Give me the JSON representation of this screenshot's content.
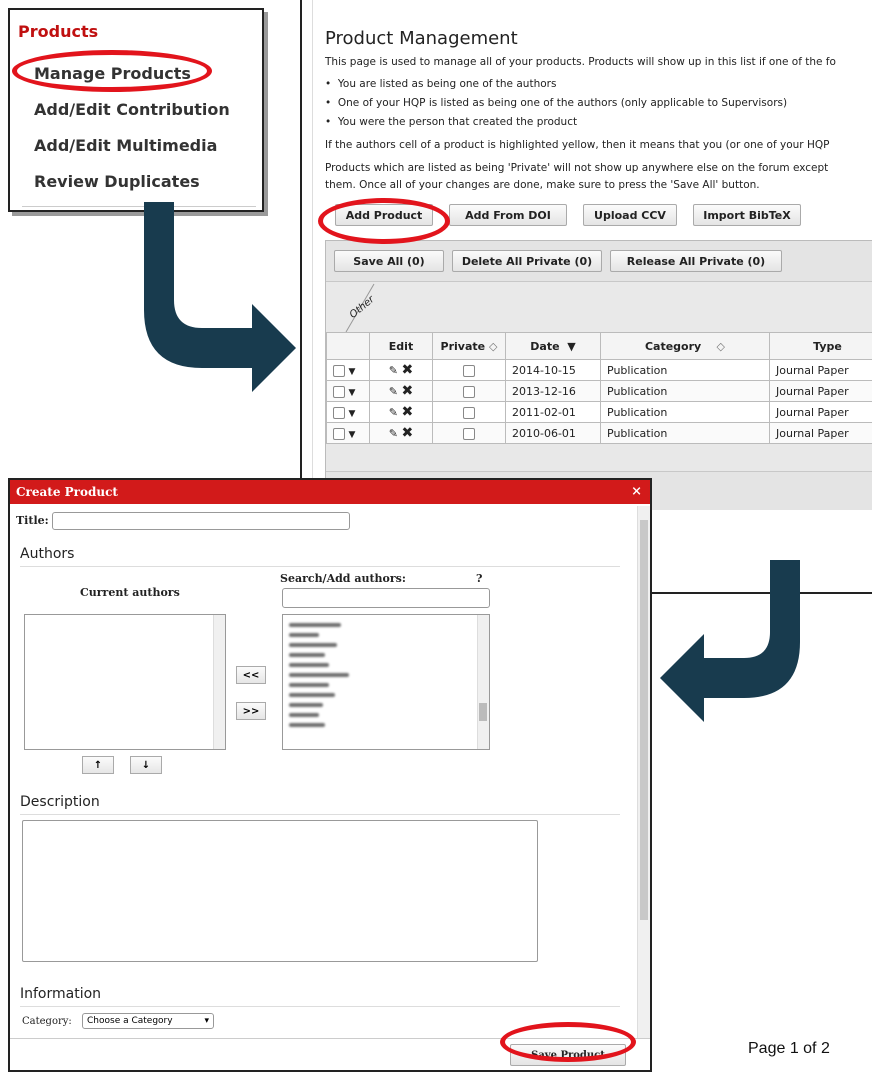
{
  "sidebar": {
    "heading": "Products",
    "items": [
      {
        "label": "Manage Products"
      },
      {
        "label": "Add/Edit Contribution"
      },
      {
        "label": "Add/Edit Multimedia"
      },
      {
        "label": "Review Duplicates"
      }
    ]
  },
  "page": {
    "title": "Product Management",
    "intro": "This page is used to manage all of your products. Products will show up in this list if one of the fo",
    "bullets": [
      "You are listed as being one of the authors",
      "One of your HQP is listed as being one of the authors (only applicable to Supervisors)",
      "You were the person that created the product"
    ],
    "note1": "If the authors cell of a product is highlighted yellow, then it means that you (or one of your HQP",
    "note2a": "Products which are listed as being 'Private' will not show up anywhere else on the forum except",
    "note2b": "them. Once all of your changes are done, make sure to press the 'Save All' button.",
    "buttons": {
      "add_product": "Add Product",
      "add_from_doi": "Add From DOI",
      "upload_ccv": "Upload CCV",
      "import_bibtex": "Import BibTeX"
    },
    "toolbar": {
      "save_all": "Save All (0)",
      "delete_all_private": "Delete All Private (0)",
      "release_all_private": "Release All Private (0)"
    },
    "filter_label": "Other",
    "table": {
      "headers": [
        "Edit",
        "Private",
        "Date",
        "Category",
        "Type"
      ],
      "rows": [
        {
          "date": "2014-10-15",
          "category": "Publication",
          "type": "Journal Paper"
        },
        {
          "date": "2013-12-16",
          "category": "Publication",
          "type": "Journal Paper"
        },
        {
          "date": "2011-02-01",
          "category": "Publication",
          "type": "Journal Paper"
        },
        {
          "date": "2010-06-01",
          "category": "Publication",
          "type": "Journal Paper"
        }
      ]
    }
  },
  "dialog": {
    "title": "Create Product",
    "close_glyph": "×",
    "title_label": "Title:",
    "title_value": "",
    "authors_section": "Authors",
    "current_authors_label": "Current authors",
    "search_authors_label": "Search/Add authors:",
    "help_glyph": "?",
    "move_left": "<<",
    "move_right": ">>",
    "move_up": "↑",
    "move_down": "↓",
    "description_section": "Description",
    "information_section": "Information",
    "category_label": "Category:",
    "category_value": "Choose a Category",
    "save_button": "Save Product"
  },
  "footer": {
    "page_number": "Page 1 of 2"
  },
  "icons": {
    "edit": "edit-icon",
    "delete": "delete-icon",
    "sort": "sort-icon",
    "expand": "expand-triangle-icon",
    "arrow": "curved-arrow-icon"
  },
  "colors": {
    "accent_red": "#d21a1a",
    "highlight_ring": "#e2141c",
    "arrow_fill": "#183b4e",
    "sidebar_heading": "#c01010"
  }
}
